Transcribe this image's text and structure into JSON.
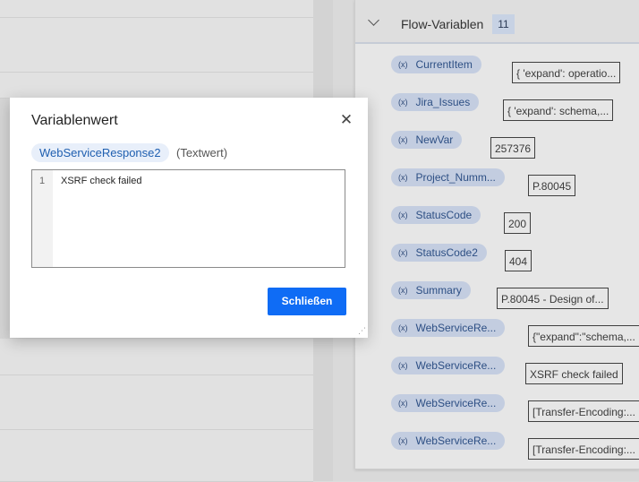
{
  "flow_panel": {
    "title": "Flow-Variablen",
    "count": "11",
    "variables": [
      {
        "icon": "(x)",
        "name": "CurrentItem",
        "value": "{ 'expand': operatio..."
      },
      {
        "icon": "(x)",
        "name": "Jira_Issues",
        "value": "{ 'expand': schema,..."
      },
      {
        "icon": "(x)",
        "name": "NewVar",
        "value": "257376"
      },
      {
        "icon": "(x)",
        "name": "Project_Numm...",
        "value": "P.80045"
      },
      {
        "icon": "(x)",
        "name": "StatusCode",
        "value": "200"
      },
      {
        "icon": "(x)",
        "name": "StatusCode2",
        "value": "404"
      },
      {
        "icon": "(x)",
        "name": "Summary",
        "value": "P.80045 - Design of..."
      },
      {
        "icon": "(x)",
        "name": "WebServiceRe...",
        "value": "{\"expand\":\"schema,..."
      },
      {
        "icon": "(x)",
        "name": "WebServiceRe...",
        "value": "XSRF check failed"
      },
      {
        "icon": "(x)",
        "name": "WebServiceRe...",
        "value": "[Transfer-Encoding:..."
      },
      {
        "icon": "(x)",
        "name": "WebServiceRe...",
        "value": "[Transfer-Encoding:..."
      }
    ]
  },
  "dialog": {
    "title": "Variablenwert",
    "close_icon": "✕",
    "variable_name": "WebServiceResponse2",
    "variable_type": "(Textwert)",
    "editor": {
      "line_number": "1",
      "line_text": "XSRF check failed"
    },
    "close_button_label": "Schließen"
  },
  "colors": {
    "primary_button": "#0f6cf5",
    "variable_chip": "#c3cde0",
    "variable_pill": "#e8effa"
  }
}
